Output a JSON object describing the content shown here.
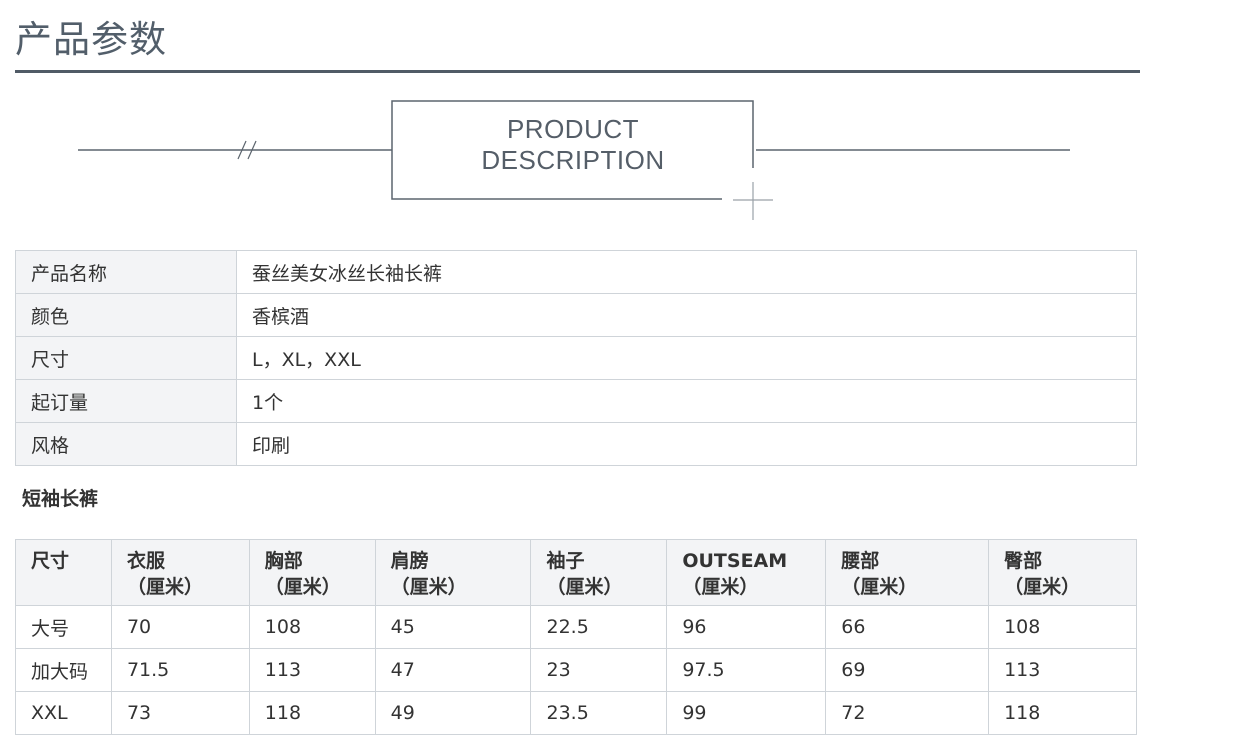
{
  "section_title": "产品参数",
  "banner": {
    "line1": "PRODUCT",
    "line2": "DESCRIPTION"
  },
  "info": [
    {
      "label": "产品名称",
      "value": "蚕丝美女冰丝长袖长裤"
    },
    {
      "label": "颜色",
      "value": "香槟酒"
    },
    {
      "label": "尺寸",
      "value": "L，XL，XXL"
    },
    {
      "label": "起订量",
      "value": "1个"
    },
    {
      "label": "风格",
      "value": "印刷"
    }
  ],
  "size_section": {
    "heading": "短袖长裤",
    "headers": [
      {
        "name": "尺寸",
        "unit": ""
      },
      {
        "name": "衣服",
        "unit": "（厘米）"
      },
      {
        "name": "胸部",
        "unit": "（厘米）"
      },
      {
        "name": "肩膀",
        "unit": "（厘米）"
      },
      {
        "name": "袖子",
        "unit": "（厘米）"
      },
      {
        "name": "OUTSEAM",
        "unit": "（厘米）"
      },
      {
        "name": "腰部",
        "unit": "（厘米）"
      },
      {
        "name": "臀部",
        "unit": "（厘米）"
      }
    ],
    "rows": [
      [
        "大号",
        "70",
        "108",
        "45",
        "22.5",
        "96",
        "66",
        "108"
      ],
      [
        "加大码",
        "71.5",
        "113",
        "47",
        "23",
        "97.5",
        "69",
        "113"
      ],
      [
        "XXL",
        "73",
        "118",
        "49",
        "23.5",
        "99",
        "72",
        "118"
      ]
    ]
  },
  "colors": {
    "title": "#525e6a",
    "rule": "#505b66",
    "border": "#cfd4d9",
    "label_bg": "#f3f4f6",
    "text": "#333333"
  }
}
